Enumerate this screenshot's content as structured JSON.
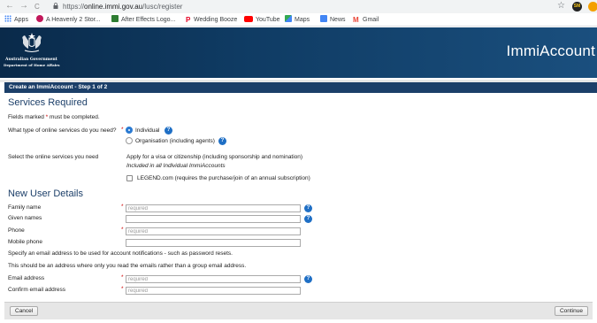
{
  "browser": {
    "back": "←",
    "forward": "→",
    "reload": "C",
    "url_prefix": "https://",
    "url_host": "online.immi.gov.au",
    "url_path": "/lusc/register",
    "profile_initials": "SM"
  },
  "bookmarks": [
    {
      "label": "Apps",
      "color": "#4285f4"
    },
    {
      "label": "A Heavenly 2 Stor...",
      "color": "#c2185b"
    },
    {
      "label": "After Effects Logo...",
      "color": "#2e7d32"
    },
    {
      "label": "Wedding Booze",
      "color": "#e60023"
    },
    {
      "label": "YouTube",
      "color": "#ff0000"
    },
    {
      "label": "Maps",
      "color": "#34a853"
    },
    {
      "label": "News",
      "color": "#4285f4"
    },
    {
      "label": "Gmail",
      "color": "#ea4335"
    }
  ],
  "header": {
    "gov_line1": "Australian Government",
    "gov_line2": "Department of Home Affairs",
    "brand": "ImmiAccount"
  },
  "step_title": "Create an ImmiAccount - Step 1 of 2",
  "services": {
    "heading": "Services Required",
    "fields_note_pre": "Fields marked ",
    "fields_note_star": "*",
    "fields_note_post": " must be completed.",
    "type_question": "What type of online services do you need?",
    "options": [
      {
        "label": "Individual",
        "selected": true
      },
      {
        "label": "Organisation (including agents)",
        "selected": false
      }
    ],
    "select_label": "Select the online services you need",
    "service_line": "Apply for a visa or citizenship (including sponsorship and nomination)",
    "included_note": "Included in all Individual ImmiAccounts",
    "legend_option": "LEGEND.com (requires the purchase/join of an annual subscription)"
  },
  "user_details": {
    "heading": "New User Details",
    "fields": [
      {
        "label": "Family name",
        "required": true,
        "placeholder": "required",
        "help": true
      },
      {
        "label": "Given names",
        "required": false,
        "placeholder": "",
        "help": true
      },
      {
        "label": "Phone",
        "required": true,
        "placeholder": "required",
        "help": false
      },
      {
        "label": "Mobile phone",
        "required": false,
        "placeholder": "",
        "help": false
      }
    ],
    "email_note1": "Specify an email address to be used for account notifications - such as password resets.",
    "email_note2": "This should be an address where only you read the emails rather than a group email address.",
    "email_fields": [
      {
        "label": "Email address",
        "required": true,
        "placeholder": "required",
        "help": true
      },
      {
        "label": "Confirm email address",
        "required": true,
        "placeholder": "required",
        "help": false
      }
    ]
  },
  "buttons": {
    "cancel": "Cancel",
    "continue": "Continue"
  },
  "help_glyph": "?",
  "required_star": "*"
}
